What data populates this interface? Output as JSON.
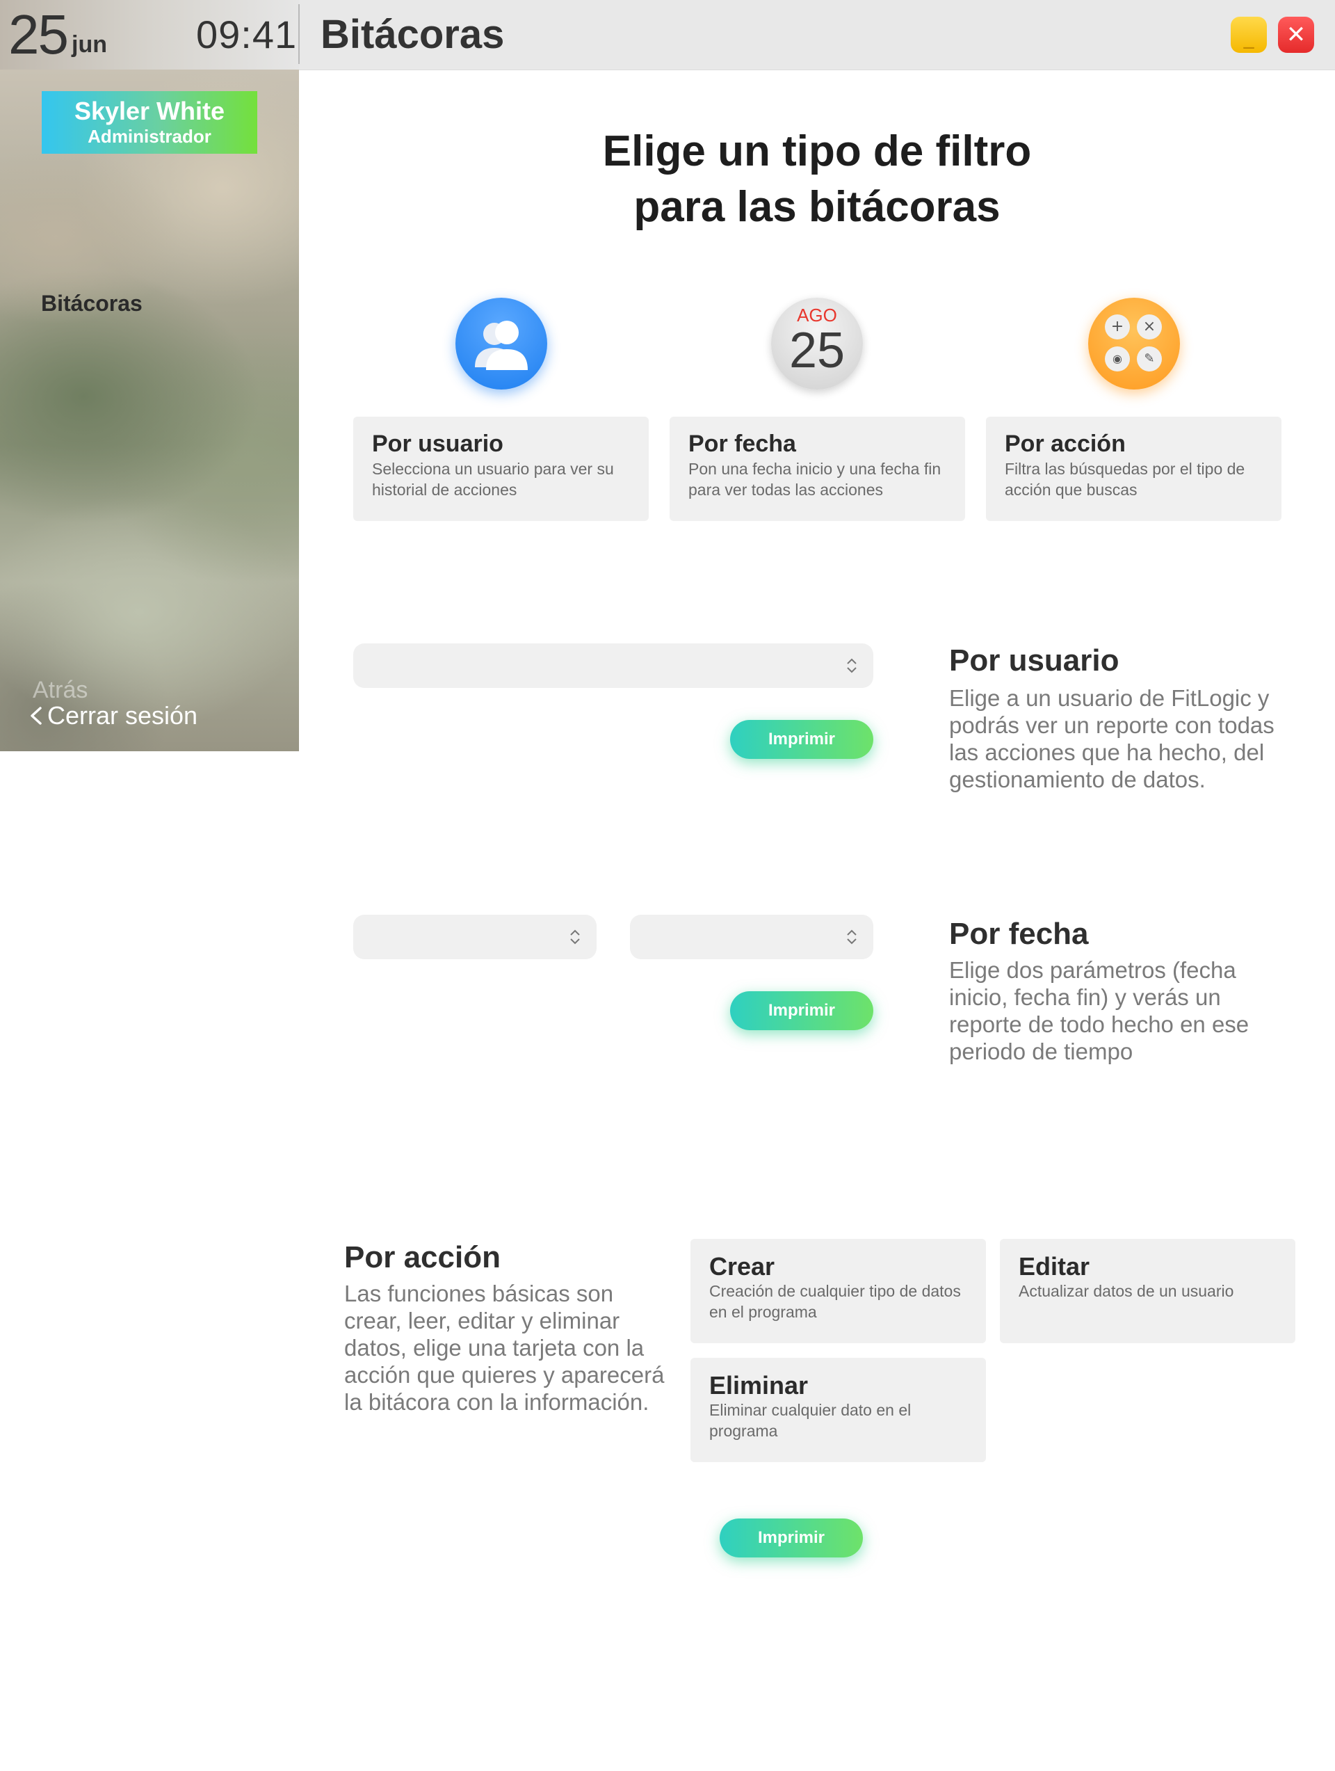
{
  "topbar": {
    "date_day": "25",
    "date_month": "jun",
    "time": "09:41",
    "title": "Bitácoras",
    "minimize_symbol": "_",
    "close_symbol": "✕"
  },
  "sidebar": {
    "user_name": "Skyler White",
    "user_role": "Administrador",
    "items": [
      {
        "label": "Bitácoras"
      }
    ],
    "back_label": "Atrás",
    "logout_label": "Cerrar sesión"
  },
  "main": {
    "heading_line1": "Elige un tipo de filtro",
    "heading_line2": "para las bitácoras",
    "calendar_icon": {
      "month": "AGO",
      "day": "25"
    },
    "action_icon": {
      "symbols": [
        "+",
        "×",
        "◉",
        "✎"
      ]
    },
    "filters": [
      {
        "title": "Por usuario",
        "desc": "Selecciona un usuario para ver su historial de acciones",
        "icon": "users-icon"
      },
      {
        "title": "Por fecha",
        "desc": "Pon una fecha inicio y una fecha fin para ver todas las acciones",
        "icon": "calendar-icon"
      },
      {
        "title": "Por acción",
        "desc": "Filtra las búsquedas por el tipo de acción que buscas",
        "icon": "actions-icon"
      }
    ],
    "by_user": {
      "title": "Por usuario",
      "text": "Elige a un usuario de FitLogic y podrás ver un reporte con todas las acciones que ha hecho, del gestionamiento de datos.",
      "select_value": "",
      "print_label": "Imprimir"
    },
    "by_date": {
      "title": "Por fecha",
      "text": "Elige dos parámetros (fecha inicio, fecha fin) y verás un reporte de todo hecho en ese periodo de tiempo",
      "start_value": "",
      "end_value": "",
      "print_label": "Imprimir"
    },
    "by_action": {
      "title": "Por acción",
      "text": "Las funciones básicas son crear, leer, editar y eliminar datos, elige una tarjeta con la acción que quieres y aparecerá la bitácora con la información.",
      "cards": [
        {
          "title": "Crear",
          "desc": "Creación de cualquier tipo de datos en el programa"
        },
        {
          "title": "Editar",
          "desc": "Actualizar datos de un usuario"
        },
        {
          "title": "Eliminar",
          "desc": "Eliminar cualquier dato en el programa"
        }
      ],
      "print_label": "Imprimir"
    }
  },
  "colors": {
    "accent_gradient_start": "#2fd0c0",
    "accent_gradient_end": "#6ee26a",
    "minimize_button": "#f5b800",
    "close_button": "#e52b2b",
    "user_icon": "#1e7ff0",
    "action_icon": "#ff9a1f"
  }
}
